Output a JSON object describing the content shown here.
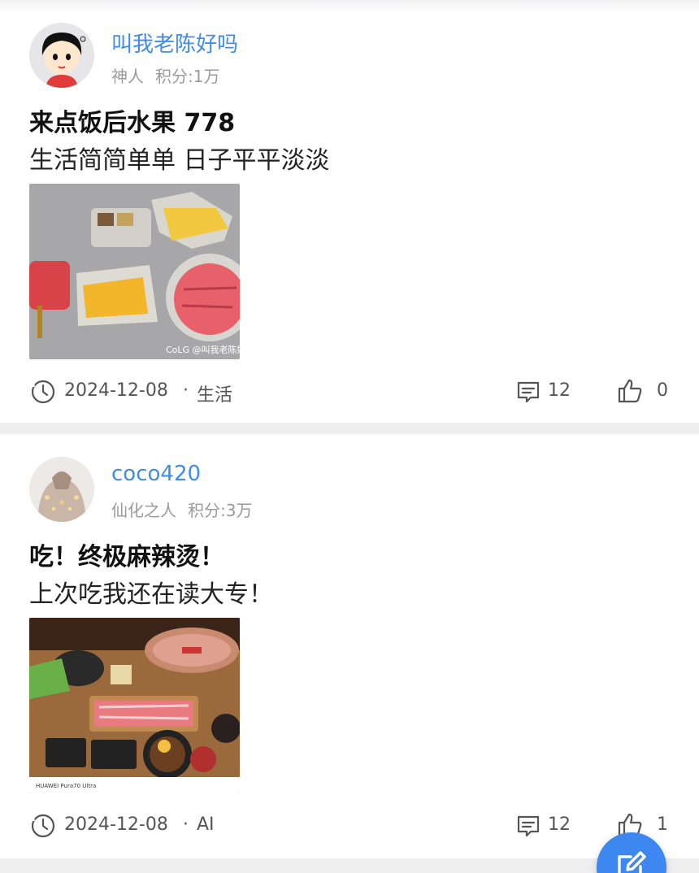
{
  "posts": [
    {
      "username": "叫我老陈好吗",
      "rank": "神人",
      "points": "积分:1万",
      "title": "来点饭后水果 778",
      "body": "生活简简单单 日子平平淡淡",
      "image_watermark": "CoLG @叫我老陈好",
      "date": "2024-12-08",
      "separator": "·",
      "category": "生活",
      "comment_count": "12",
      "like_count": "0"
    },
    {
      "username": "coco420",
      "rank": "仙化之人",
      "points": "积分:3万",
      "title": "吃！终极麻辣烫！",
      "body": "上次吃我还在读大专！",
      "image_watermark": "HUAWEI Pura70 Ultra",
      "date": "2024-12-08",
      "separator": "·",
      "category": "AI",
      "comment_count": "12",
      "like_count": "1"
    }
  ],
  "icons": {
    "clock": "clock-icon",
    "comment": "comment-icon",
    "like": "thumbs-up-icon",
    "compose": "pencil-edit-icon"
  },
  "colors": {
    "username": "#3f8de8",
    "fab": "#3d87f0",
    "separator": "#eeeeef",
    "meta": "#9a9a9a"
  }
}
